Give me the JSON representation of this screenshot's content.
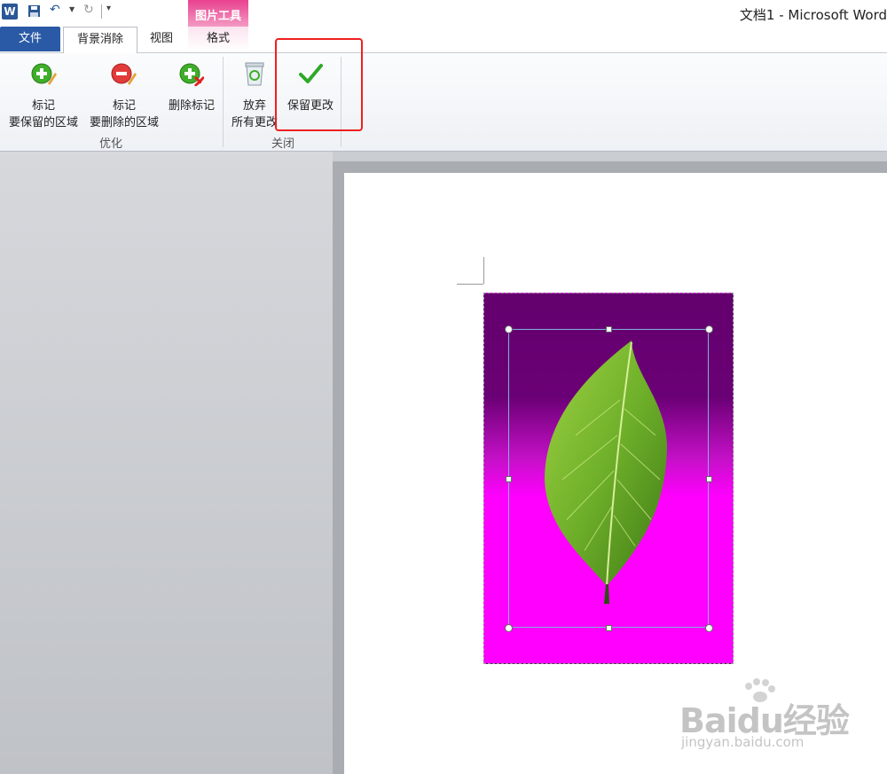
{
  "window": {
    "title": "文档1 - Microsoft Word"
  },
  "qat": {
    "app_icon": "W"
  },
  "context_tab": {
    "header": "图片工具"
  },
  "tabs": [
    {
      "label": "文件"
    },
    {
      "label": "背景消除"
    },
    {
      "label": "视图"
    },
    {
      "label": "格式"
    }
  ],
  "ribbon": {
    "groups": [
      {
        "label": "优化",
        "buttons": [
          {
            "line1": "标记",
            "line2": "要保留的区域",
            "icon": "mark-keep-icon"
          },
          {
            "line1": "标记",
            "line2": "要删除的区域",
            "icon": "mark-remove-icon"
          },
          {
            "line1": "删除标记",
            "line2": "",
            "icon": "delete-mark-icon"
          }
        ]
      },
      {
        "label": "关闭",
        "buttons": [
          {
            "line1": "放弃",
            "line2": "所有更改",
            "icon": "discard-icon"
          },
          {
            "line1": "保留更改",
            "line2": "",
            "icon": "checkmark-icon"
          }
        ]
      }
    ]
  },
  "watermark": {
    "main": "Baidu经验",
    "sub": "jingyan.baidu.com"
  },
  "colors": {
    "file_tab": "#2a5aa5",
    "context_pink": "#e9418f",
    "highlight": "#ef2020",
    "removed_bg": "#ff00ff"
  }
}
